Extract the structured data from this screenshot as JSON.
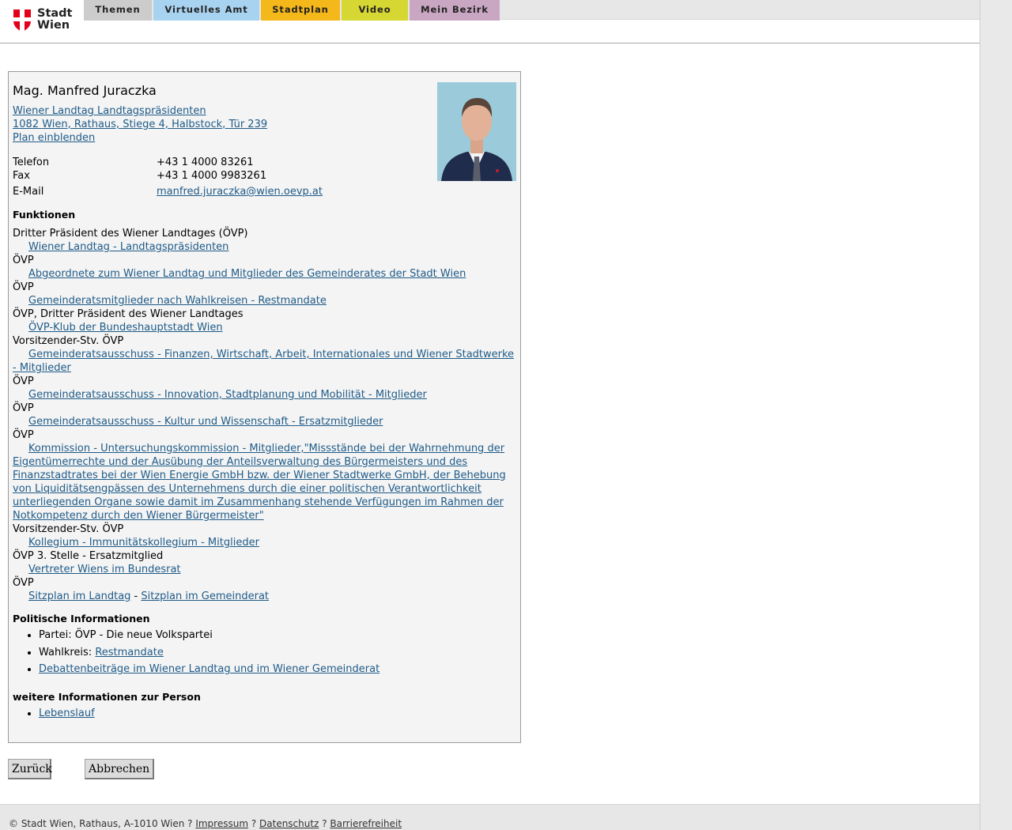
{
  "header": {
    "logo_line1": "Stadt",
    "logo_line2": "Wien",
    "tabs": [
      {
        "label": "Themen",
        "color": "#cccccc"
      },
      {
        "label": "Virtuelles Amt",
        "color": "#a8d3f0"
      },
      {
        "label": "Stadtplan",
        "color": "#f5b81a"
      },
      {
        "label": "Video",
        "color": "#d6d733"
      },
      {
        "label": "Mein Bezirk",
        "color": "#c9a6c1"
      }
    ]
  },
  "person": {
    "name": "Mag. Manfred Juraczka",
    "org_link": "Wiener Landtag Landtagspräsidenten",
    "address_link": "1082 Wien, Rathaus, Stiege 4, Halbstock, Tür 239",
    "plan_link": "Plan einblenden",
    "contact": {
      "phone_label": "Telefon",
      "phone": "+43 1 4000 83261",
      "fax_label": "Fax",
      "fax": "+43 1 4000 9983261",
      "email_label": "E-Mail",
      "email": "manfred.juraczka@wien.oevp.at"
    }
  },
  "functions": {
    "heading": "Funktionen",
    "items": [
      {
        "role": "Dritter Präsident des Wiener Landtages (ÖVP)",
        "org": "Wiener Landtag - Landtagspräsidenten"
      },
      {
        "role": "ÖVP",
        "org": "Abgeordnete zum Wiener Landtag und Mitglieder des Gemeinderates der Stadt Wien"
      },
      {
        "role": "ÖVP",
        "org": "Gemeinderatsmitglieder nach Wahlkreisen - Restmandate"
      },
      {
        "role": "ÖVP, Dritter Präsident des Wiener Landtages",
        "org": "ÖVP-Klub der Bundeshauptstadt Wien"
      },
      {
        "role": "Vorsitzender-Stv. ÖVP",
        "org": "Gemeinderatsausschuss - Finanzen, Wirtschaft, Arbeit, Internationales und Wiener Stadtwerke - Mitglieder"
      },
      {
        "role": "ÖVP",
        "org": "Gemeinderatsausschuss - Innovation, Stadtplanung und Mobilität - Mitglieder"
      },
      {
        "role": "ÖVP",
        "org": "Gemeinderatsausschuss - Kultur und Wissenschaft - Ersatzmitglieder"
      },
      {
        "role": "ÖVP",
        "org": "Kommission - Untersuchungskommission - Mitglieder,\"Missstände bei der Wahrnehmung der Eigentümerrechte und der Ausübung der Anteilsverwaltung des Bürgermeisters und des Finanzstadtrates bei der Wien Energie GmbH bzw. der Wiener Stadtwerke GmbH, der Behebung von Liquiditätsengpässen des Unternehmens durch die einer politischen Verantwortlichkeit unterliegenden Organe sowie damit im Zusammenhang stehende Verfügungen im Rahmen der Notkompetenz durch den Wiener Bürgermeister\""
      },
      {
        "role": "Vorsitzender-Stv. ÖVP",
        "org": "Kollegium - Immunitätskollegium - Mitglieder"
      },
      {
        "role": "ÖVP 3. Stelle - Ersatzmitglied",
        "org": "Vertreter Wiens im Bundesrat"
      },
      {
        "role": "ÖVP",
        "org": ""
      }
    ],
    "seat_landtag": "Sitzplan im Landtag",
    "seat_separator": " - ",
    "seat_gemeinderat": "Sitzplan im Gemeinderat"
  },
  "political": {
    "heading": "Politische Informationen",
    "party": "Partei: ÖVP - Die neue Volkspartei",
    "wahlkreis_label": "Wahlkreis: ",
    "wahlkreis_link": "Restmandate",
    "debate_link": "Debattenbeiträge im Wiener Landtag und im Wiener Gemeinderat"
  },
  "more": {
    "heading": "weitere Informationen zur Person",
    "cv_link": "Lebenslauf"
  },
  "buttons": {
    "back": "Zurück",
    "cancel": "Abbrechen"
  },
  "footer": {
    "copyright": "© Stadt Wien, Rathaus, A-1010 Wien",
    "sep": " ? ",
    "impressum": "Impressum",
    "datenschutz": "Datenschutz",
    "barrierefreiheit": "Barrierefreiheit"
  }
}
